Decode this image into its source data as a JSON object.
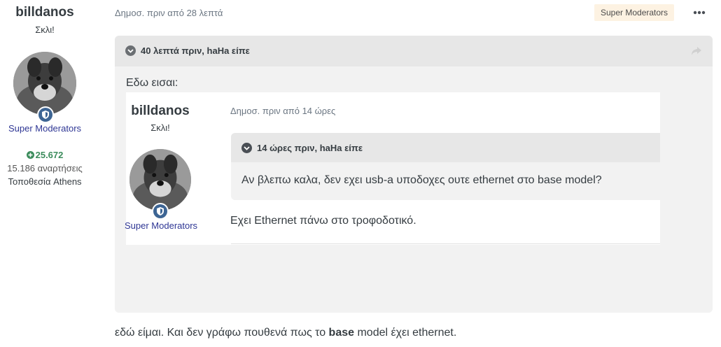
{
  "author": {
    "name": "billdanos",
    "title": "Σκλι!",
    "group": "Super Moderators",
    "reputation": "25.672",
    "posts": "15.186 αναρτήσεις",
    "location": "Τοποθεσία Athens"
  },
  "post": {
    "date": "Δημοσ. πριν από 28 λεπτά",
    "badge": "Super Moderators",
    "quote": {
      "header": "40 λεπτά πριν, haHa είπε",
      "text": "Εδω εισαι:",
      "embed": {
        "author_name": "billdanos",
        "author_title": "Σκλι!",
        "author_group": "Super Moderators",
        "date": "Δημοσ. πριν από 14 ώρες",
        "inner_quote": {
          "header": "14 ώρες πριν, haHa είπε",
          "text": "Αν βλεπω καλα, δεν εχει usb-a υποδοχες ουτε ethernet στο base model?"
        },
        "reply": "Εχει Ethernet πάνω στο τροφοδοτικό."
      }
    },
    "reply_before": "εδώ είμαι. Και δεν γράφω πουθενά πως το ",
    "reply_bold": "base",
    "reply_after": " model έχει ethernet."
  },
  "colors": {
    "accent": "#3d6594",
    "group_link": "#2e3694",
    "reputation": "#3c8c5c",
    "badge_bg": "#fdf2e2"
  },
  "icons": [
    "chevron-down-icon",
    "share-icon",
    "more-icon",
    "shield-icon",
    "plus-circle-icon"
  ]
}
